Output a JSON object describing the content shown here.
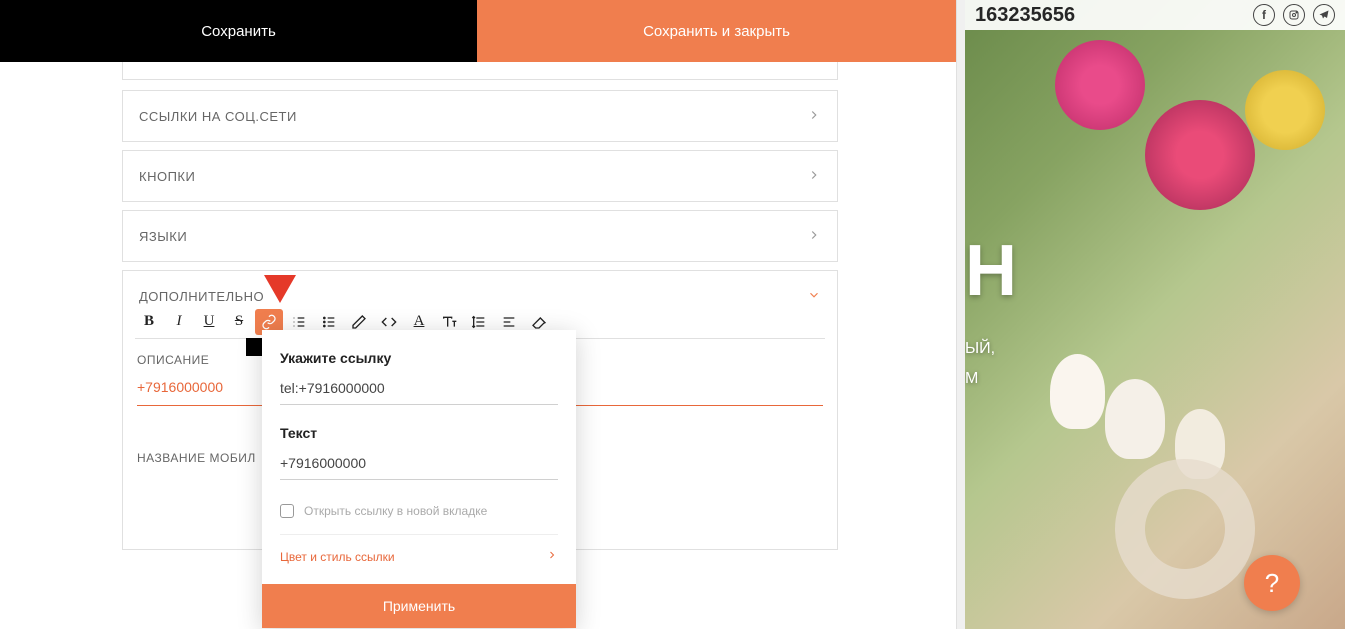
{
  "topbar": {
    "save": "Сохранить",
    "save_close": "Сохранить и закрыть"
  },
  "panels": {
    "social": "ССЫЛКИ НА СОЦ.СЕТИ",
    "buttons": "КНОПКИ",
    "langs": "ЯЗЫКИ",
    "more": "ДОПОЛНИТЕЛЬНО",
    "desc_label": "ОПИСАНИЕ",
    "desc_value": "+7916000000",
    "mob_label": "НАЗВАНИЕ МОБИЛ"
  },
  "popup": {
    "link_label": "Укажите ссылку",
    "link_value": "tel:+7916000000",
    "text_label": "Текст",
    "text_value": "+7916000000",
    "newtab": "Открыть ссылку в новой вкладке",
    "style_link": "Цвет и стиль ссылки",
    "apply": "Применить"
  },
  "preview": {
    "phone": "163235656",
    "big_letter": "Н",
    "line1": "ЫЙ,",
    "line2": "М"
  },
  "fab": "?",
  "icons": {
    "bold": "B",
    "italic": "I",
    "underline": "U",
    "strike": "S"
  }
}
